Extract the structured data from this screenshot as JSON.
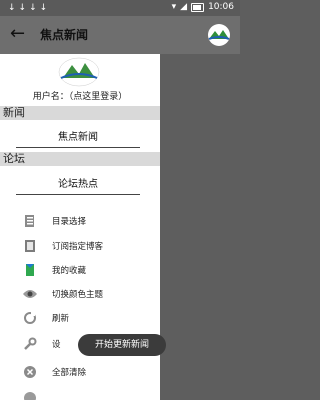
{
  "status_bar": {
    "time": "10:06",
    "left_icons": "↓↓↓↓"
  },
  "app_bar": {
    "title": "焦点新闻"
  },
  "drawer": {
    "user_line": "用户名：（点这里登录）",
    "sections": [
      {
        "header": "新闻",
        "item": "焦点新闻"
      },
      {
        "header": "论坛",
        "item": "论坛热点"
      }
    ],
    "menu": [
      {
        "label": "目录选择",
        "icon": "directory-icon"
      },
      {
        "label": "订阅指定博客",
        "icon": "subscribe-icon"
      },
      {
        "label": "我的收藏",
        "icon": "favorites-icon"
      },
      {
        "label": "切换颜色主题",
        "icon": "eye-icon"
      },
      {
        "label": "刷新",
        "icon": "refresh-icon"
      },
      {
        "label": "设",
        "icon": "settings-icon"
      },
      {
        "label": "全部清除",
        "icon": "clear-icon"
      },
      {
        "label": "",
        "icon": "exit-icon"
      }
    ]
  },
  "toast": {
    "text": "开始更新新闻"
  }
}
